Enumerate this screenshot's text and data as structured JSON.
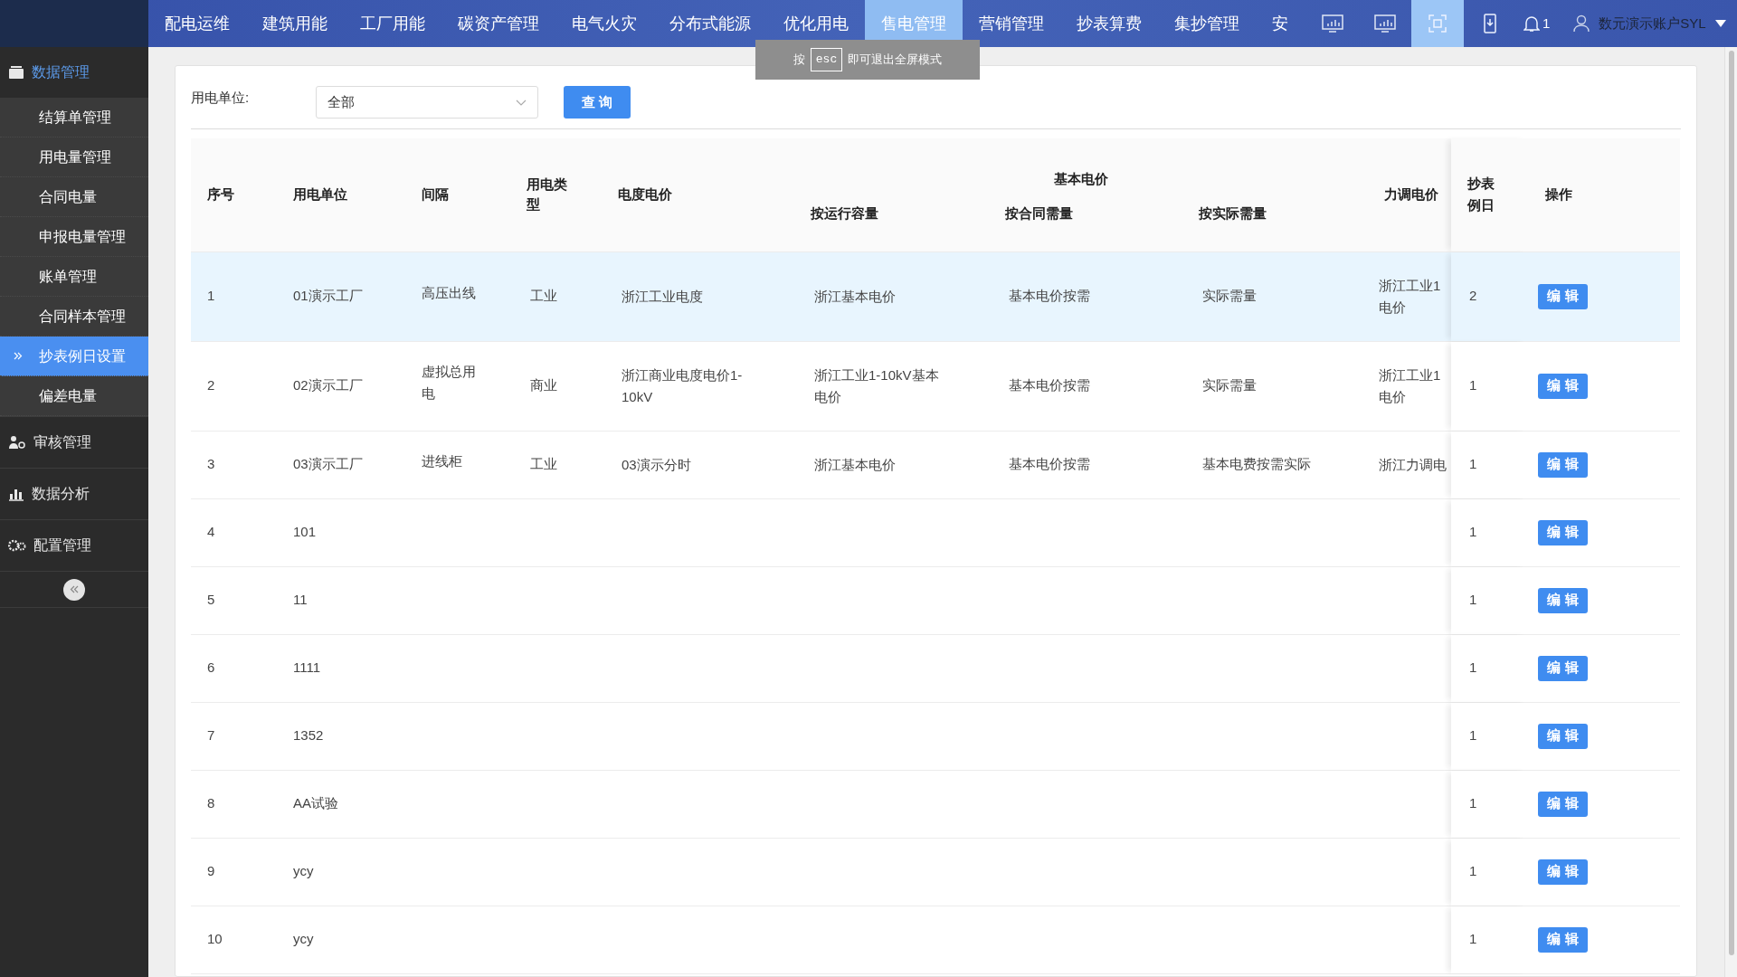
{
  "top_nav": {
    "items": [
      {
        "label": "配电运维",
        "selected": false
      },
      {
        "label": "建筑用能",
        "selected": false
      },
      {
        "label": "工厂用能",
        "selected": false
      },
      {
        "label": "碳资产管理",
        "selected": false
      },
      {
        "label": "电气火灾",
        "selected": false
      },
      {
        "label": "分布式能源",
        "selected": false
      },
      {
        "label": "优化用电",
        "selected": false
      },
      {
        "label": "售电管理",
        "selected": true
      },
      {
        "label": "营销管理",
        "selected": false
      },
      {
        "label": "抄表算费",
        "selected": false
      },
      {
        "label": "集抄管理",
        "selected": false
      },
      {
        "label": "安",
        "selected": false
      }
    ],
    "tools": [
      {
        "kind": "monitor",
        "selected": false
      },
      {
        "kind": "monitor",
        "selected": false
      },
      {
        "kind": "fullscreen",
        "selected": true
      },
      {
        "kind": "phone",
        "selected": false
      }
    ],
    "notifications": "1",
    "user": "数元演示账户SYL"
  },
  "fullscreen_hint": {
    "before": "按",
    "key": "esc",
    "after": "即可退出全屏模式"
  },
  "sidebar": {
    "items": [
      {
        "label": "数据管理",
        "kind": "folder",
        "expanded": true,
        "children": [
          {
            "label": "结算单管理",
            "selected": false
          },
          {
            "label": "用电量管理",
            "selected": false
          },
          {
            "label": "合同电量",
            "selected": false
          },
          {
            "label": "申报电量管理",
            "selected": false
          },
          {
            "label": "账单管理",
            "selected": false
          },
          {
            "label": "合同样本管理",
            "selected": false
          },
          {
            "label": "抄表例日设置",
            "selected": true
          },
          {
            "label": "偏差电量",
            "selected": false
          }
        ]
      },
      {
        "label": "审核管理",
        "kind": "user",
        "expanded": false
      },
      {
        "label": "数据分析",
        "kind": "chart",
        "expanded": false
      },
      {
        "label": "配置管理",
        "kind": "gears",
        "expanded": false
      }
    ]
  },
  "filter": {
    "label": "用电单位:",
    "select_value": "全部",
    "button": "查 询"
  },
  "table": {
    "columns": {
      "index": "序号",
      "unit": "用电单位",
      "bay": "间隔",
      "type": "用电类型",
      "energy_price": "电度电价",
      "group": "基本电价",
      "by_capacity": "按运行容量",
      "by_contract": "按合同需量",
      "by_actual": "按实际需量",
      "pf_price": "力调电价",
      "reading_day": "抄表例日",
      "action": "操作"
    },
    "rows": [
      {
        "selected": true,
        "index": "1",
        "unit": "01演示工厂",
        "bay": "高压出线",
        "type": "工业",
        "energy_price": "浙江工业电度",
        "by_capacity": "浙江基本电价",
        "by_contract": "基本电价按需",
        "by_actual": "实际需量",
        "pf_price": [
          "浙江工业1",
          "电价"
        ],
        "reading_day": "2",
        "action": "编 辑"
      },
      {
        "selected": false,
        "index": "2",
        "unit": "02演示工厂",
        "bay": "虚拟总用电",
        "type": "商业",
        "energy_price": "浙江商业电度电价1-10kV",
        "by_capacity": "浙江工业1-10kV基本电价",
        "by_contract": "基本电价按需",
        "by_actual": "实际需量",
        "pf_price": [
          "浙江工业1",
          "电价"
        ],
        "reading_day": "1",
        "action": "编 辑"
      },
      {
        "selected": false,
        "index": "3",
        "unit": "03演示工厂",
        "bay": "进线柜",
        "type": "工业",
        "energy_price": "03演示分时",
        "by_capacity": "浙江基本电价",
        "by_contract": "基本电价按需",
        "by_actual": "基本电费按需实际",
        "pf_price": [
          "浙江力调电"
        ],
        "reading_day": "1",
        "action": "编 辑"
      },
      {
        "selected": false,
        "index": "4",
        "unit": "101",
        "reading_day": "1",
        "action": "编 辑"
      },
      {
        "selected": false,
        "index": "5",
        "unit": "11",
        "reading_day": "1",
        "action": "编 辑"
      },
      {
        "selected": false,
        "index": "6",
        "unit": "1111",
        "reading_day": "1",
        "action": "编 辑"
      },
      {
        "selected": false,
        "index": "7",
        "unit": "1352",
        "reading_day": "1",
        "action": "编 辑"
      },
      {
        "selected": false,
        "index": "8",
        "unit": "AA试验",
        "reading_day": "1",
        "action": "编 辑"
      },
      {
        "selected": false,
        "index": "9",
        "unit": "ycy",
        "reading_day": "1",
        "action": "编 辑"
      },
      {
        "selected": false,
        "index": "10",
        "unit": "ycy",
        "reading_day": "1",
        "action": "编 辑"
      }
    ]
  }
}
